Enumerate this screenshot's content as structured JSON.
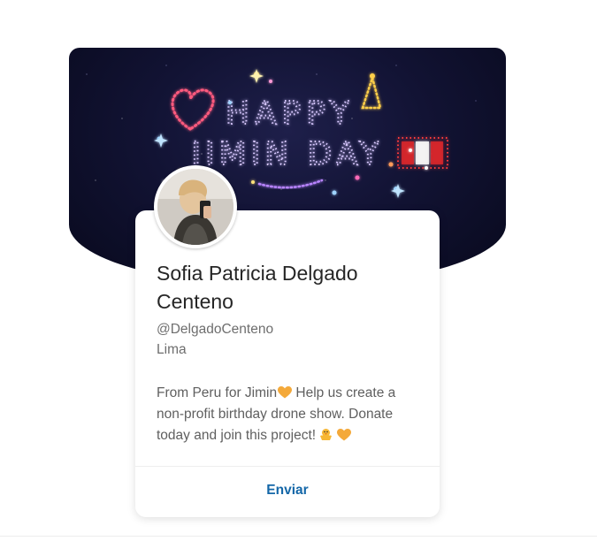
{
  "banner": {
    "line1": "HAPPY",
    "line2": "JIMIN DAY"
  },
  "profile": {
    "name": "Sofia Patricia Delgado Centeno",
    "handle": "@DelgadoCenteno",
    "location": "Lima",
    "bio_part1": "From Peru for Jimin",
    "bio_part2": " Help us create a non-profit birthday drone show. Donate today and join this project!"
  },
  "actions": {
    "send_label": "Enviar"
  },
  "colors": {
    "accent": "#1467a8",
    "banner_bg": "#121334",
    "heart": "#f4a93a"
  },
  "icons": [
    "heart-icon",
    "chick-icon",
    "peru-flag-icon",
    "party-hat-icon"
  ]
}
